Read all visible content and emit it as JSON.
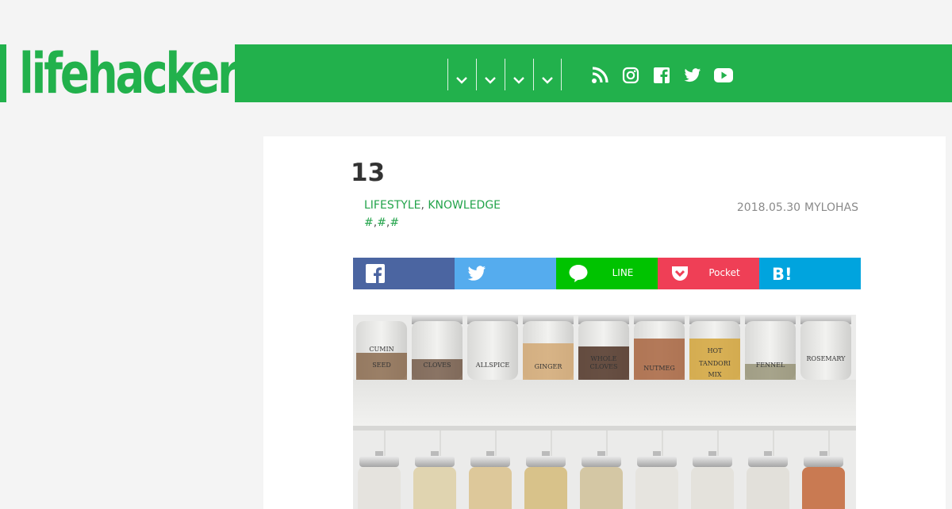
{
  "brand": {
    "logo_text": "lifehacker",
    "color": "#22b14c"
  },
  "nav": {
    "menus": [
      {
        "label": "",
        "icon": "chevron-down-icon"
      },
      {
        "label": "",
        "icon": "chevron-down-icon"
      },
      {
        "label": "",
        "icon": "chevron-down-icon"
      },
      {
        "label": "",
        "icon": "chevron-down-icon"
      }
    ],
    "social": [
      "rss-icon",
      "instagram-icon",
      "facebook-icon",
      "twitter-icon",
      "youtube-icon"
    ]
  },
  "article": {
    "title": "13",
    "categories": [
      "LIFESTYLE",
      "KNOWLEDGE"
    ],
    "tags": [
      "#",
      "#",
      "#"
    ],
    "date": "2018.05.30",
    "author": "MYLOHAS"
  },
  "share": {
    "buttons": [
      {
        "name": "facebook",
        "label": "",
        "color": "#4b65a1",
        "icon": "facebook-icon"
      },
      {
        "name": "twitter",
        "label": "",
        "color": "#55acee",
        "icon": "twitter-icon"
      },
      {
        "name": "line",
        "label": "LINE",
        "color": "#00c300",
        "icon": "line-icon"
      },
      {
        "name": "pocket",
        "label": "Pocket",
        "color": "#ef3f56",
        "icon": "pocket-icon"
      },
      {
        "name": "hatena",
        "label": "",
        "color": "#00a4de",
        "icon": "hatena-bookmark-icon"
      }
    ]
  },
  "hero": {
    "icon": "spice-jars-photo",
    "jar_labels": [
      "CUMIN SEED",
      "CLOVES",
      "ALLSPICE",
      "GINGER",
      "WHOLE CLOVES",
      "NUTMEG",
      "HOT TANDORI MIX",
      "FENNEL",
      "ROSEMARY"
    ]
  }
}
